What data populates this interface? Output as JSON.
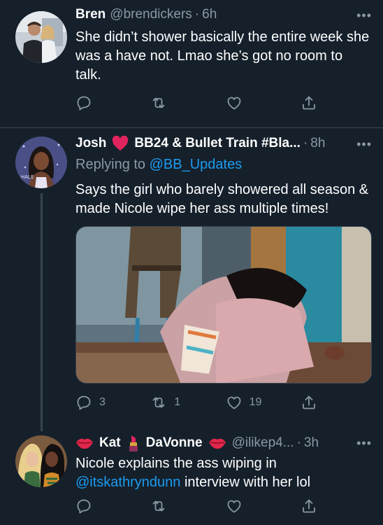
{
  "tweets": [
    {
      "name": "Bren",
      "handle": "@brendickers",
      "time": "6h",
      "text": "She didn’t shower basically the entire week she was a have not. Lmao she’s got no room to talk."
    },
    {
      "name_part1": "Josh",
      "name_part2": "BB24 & Bullet Train #Bla...",
      "time": "8h",
      "replying_prefix": "Replying to",
      "replying_handle": "@BB_Updates",
      "text": "Says the girl who barely showered all season & made Nicole wipe her ass multiple times!",
      "stats": {
        "replies": "3",
        "retweets": "1",
        "likes": "19"
      },
      "avatar_badge": "HALE"
    },
    {
      "name_part1": "Kat",
      "name_part2": "DaVonne",
      "handle": "@ilikep4...",
      "time": "3h",
      "text_before": "Nicole explains the ass wiping in",
      "mention": "@itskathryndunn",
      "text_after": "interview with her lol"
    }
  ],
  "separator_dot": "·",
  "more_label": "•••",
  "icons": [
    "reply-icon",
    "retweet-icon",
    "like-icon",
    "share-icon",
    "more-icon",
    "heart-emoji",
    "lips-emoji",
    "lipstick-emoji"
  ],
  "colors": {
    "background": "#15202b",
    "text": "#ffffff",
    "secondary": "#8b98a5",
    "link": "#1d9bf0",
    "divider": "#38444d",
    "heart": "#f91880"
  }
}
